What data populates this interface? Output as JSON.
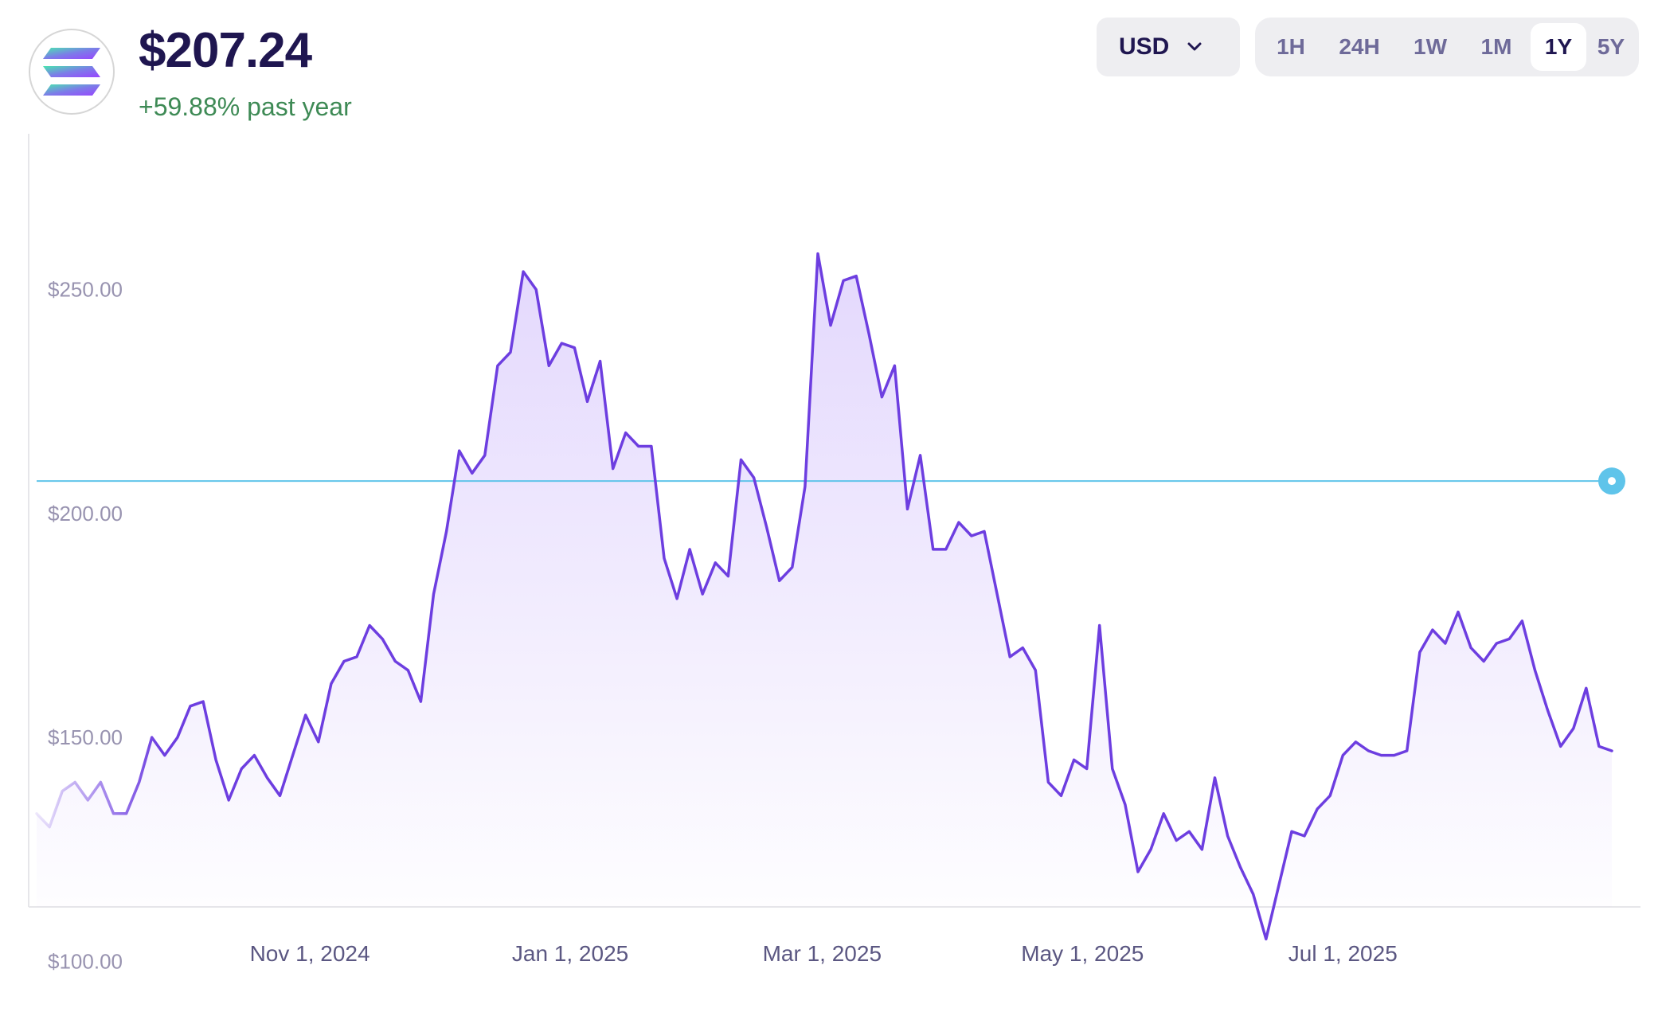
{
  "header": {
    "price": "$207.24",
    "change": "+59.88% past year"
  },
  "logo": {
    "icon": "solana-logo-icon"
  },
  "currency": {
    "label": "USD",
    "icon": "chevron-down-icon"
  },
  "ranges": [
    {
      "label": "1H",
      "active": false
    },
    {
      "label": "24H",
      "active": false
    },
    {
      "label": "1W",
      "active": false
    },
    {
      "label": "1M",
      "active": false
    },
    {
      "label": "1Y",
      "active": true
    },
    {
      "label": "5Y",
      "active": false
    }
  ],
  "colors": {
    "line": "#6d3ee0",
    "fill": "#8b5cf6",
    "current_line": "#5fc4ea",
    "positive": "#3e8a55",
    "text_dark": "#1f1650"
  },
  "chart_data": {
    "type": "area",
    "title": "",
    "xlabel": "",
    "ylabel": "",
    "grid": false,
    "ylim": [
      87.8,
      286.2
    ],
    "xlim": [
      "2024-08-29",
      "2025-09-02"
    ],
    "y_ticks": [
      "$100.00",
      "$150.00",
      "$200.00",
      "$250.00"
    ],
    "y_tick_values": [
      100,
      150,
      200,
      250
    ],
    "x_ticks": [
      "Nov 1, 2024",
      "Jan 1, 2025",
      "Mar 1, 2025",
      "May 1, 2025",
      "Jul 1, 2025"
    ],
    "x_tick_dates": [
      "2024-11-01",
      "2025-01-01",
      "2025-03-01",
      "2025-05-01",
      "2025-07-01"
    ],
    "current_value": 207.24,
    "series": [
      {
        "points": [
          [
            "2024-08-29",
            133
          ],
          [
            "2024-09-01",
            130
          ],
          [
            "2024-09-04",
            138
          ],
          [
            "2024-09-07",
            140
          ],
          [
            "2024-09-10",
            136
          ],
          [
            "2024-09-13",
            140
          ],
          [
            "2024-09-16",
            133
          ],
          [
            "2024-09-19",
            133
          ],
          [
            "2024-09-22",
            140
          ],
          [
            "2024-09-25",
            150
          ],
          [
            "2024-09-28",
            146
          ],
          [
            "2024-10-01",
            150
          ],
          [
            "2024-10-04",
            157
          ],
          [
            "2024-10-07",
            158
          ],
          [
            "2024-10-10",
            145
          ],
          [
            "2024-10-13",
            136
          ],
          [
            "2024-10-16",
            143
          ],
          [
            "2024-10-19",
            146
          ],
          [
            "2024-10-22",
            141
          ],
          [
            "2024-10-25",
            137
          ],
          [
            "2024-10-28",
            146
          ],
          [
            "2024-10-31",
            155
          ],
          [
            "2024-11-03",
            149
          ],
          [
            "2024-11-06",
            162
          ],
          [
            "2024-11-09",
            167
          ],
          [
            "2024-11-12",
            168
          ],
          [
            "2024-11-15",
            175
          ],
          [
            "2024-11-18",
            172
          ],
          [
            "2024-11-21",
            167
          ],
          [
            "2024-11-24",
            165
          ],
          [
            "2024-11-27",
            158
          ],
          [
            "2024-11-30",
            182
          ],
          [
            "2024-12-03",
            196
          ],
          [
            "2024-12-06",
            214
          ],
          [
            "2024-12-09",
            209
          ],
          [
            "2024-12-12",
            213
          ],
          [
            "2024-12-15",
            233
          ],
          [
            "2024-12-18",
            236
          ],
          [
            "2024-12-21",
            254
          ],
          [
            "2024-12-24",
            250
          ],
          [
            "2024-12-27",
            233
          ],
          [
            "2024-12-30",
            238
          ],
          [
            "2025-01-02",
            237
          ],
          [
            "2025-01-05",
            225
          ],
          [
            "2025-01-08",
            234
          ],
          [
            "2025-01-11",
            210
          ],
          [
            "2025-01-14",
            218
          ],
          [
            "2025-01-17",
            215
          ],
          [
            "2025-01-20",
            215
          ],
          [
            "2025-01-23",
            190
          ],
          [
            "2025-01-26",
            181
          ],
          [
            "2025-01-29",
            192
          ],
          [
            "2025-02-01",
            182
          ],
          [
            "2025-02-04",
            189
          ],
          [
            "2025-02-07",
            186
          ],
          [
            "2025-02-10",
            212
          ],
          [
            "2025-02-13",
            208
          ],
          [
            "2025-02-16",
            197
          ],
          [
            "2025-02-19",
            185
          ],
          [
            "2025-02-22",
            188
          ],
          [
            "2025-02-25",
            206
          ],
          [
            "2025-02-28",
            258
          ],
          [
            "2025-03-03",
            242
          ],
          [
            "2025-03-06",
            252
          ],
          [
            "2025-03-09",
            253
          ],
          [
            "2025-03-12",
            240
          ],
          [
            "2025-03-15",
            226
          ],
          [
            "2025-03-18",
            233
          ],
          [
            "2025-03-21",
            201
          ],
          [
            "2025-03-24",
            213
          ],
          [
            "2025-03-27",
            192
          ],
          [
            "2025-03-30",
            192
          ],
          [
            "2025-04-02",
            198
          ],
          [
            "2025-04-05",
            195
          ],
          [
            "2025-04-08",
            196
          ],
          [
            "2025-04-11",
            182
          ],
          [
            "2025-04-14",
            168
          ],
          [
            "2025-04-17",
            170
          ],
          [
            "2025-04-20",
            165
          ],
          [
            "2025-04-23",
            140
          ],
          [
            "2025-04-26",
            137
          ],
          [
            "2025-04-29",
            145
          ],
          [
            "2025-05-02",
            143
          ],
          [
            "2025-05-05",
            175
          ],
          [
            "2025-05-08",
            143
          ],
          [
            "2025-05-11",
            135
          ],
          [
            "2025-05-14",
            120
          ],
          [
            "2025-05-17",
            125
          ],
          [
            "2025-05-20",
            133
          ],
          [
            "2025-05-23",
            127
          ],
          [
            "2025-05-26",
            129
          ],
          [
            "2025-05-29",
            125
          ],
          [
            "2025-06-01",
            141
          ],
          [
            "2025-06-04",
            128
          ],
          [
            "2025-06-07",
            121
          ],
          [
            "2025-06-10",
            115
          ],
          [
            "2025-06-13",
            105
          ],
          [
            "2025-06-16",
            117
          ],
          [
            "2025-06-19",
            129
          ],
          [
            "2025-06-22",
            128
          ],
          [
            "2025-06-25",
            134
          ],
          [
            "2025-06-28",
            137
          ],
          [
            "2025-07-01",
            146
          ],
          [
            "2025-07-04",
            149
          ],
          [
            "2025-07-07",
            147
          ],
          [
            "2025-07-10",
            146
          ],
          [
            "2025-07-13",
            146
          ],
          [
            "2025-07-16",
            147
          ],
          [
            "2025-07-19",
            169
          ],
          [
            "2025-07-22",
            174
          ],
          [
            "2025-07-25",
            171
          ],
          [
            "2025-07-28",
            178
          ],
          [
            "2025-07-31",
            170
          ],
          [
            "2025-08-03",
            167
          ],
          [
            "2025-08-06",
            171
          ],
          [
            "2025-08-09",
            172
          ],
          [
            "2025-08-12",
            176
          ],
          [
            "2025-08-15",
            165
          ],
          [
            "2025-08-18",
            156
          ],
          [
            "2025-08-21",
            148
          ],
          [
            "2025-08-24",
            152
          ],
          [
            "2025-08-27",
            161
          ],
          [
            "2025-08-30",
            148
          ],
          [
            "2025-09-02",
            147
          ]
        ]
      }
    ]
  }
}
